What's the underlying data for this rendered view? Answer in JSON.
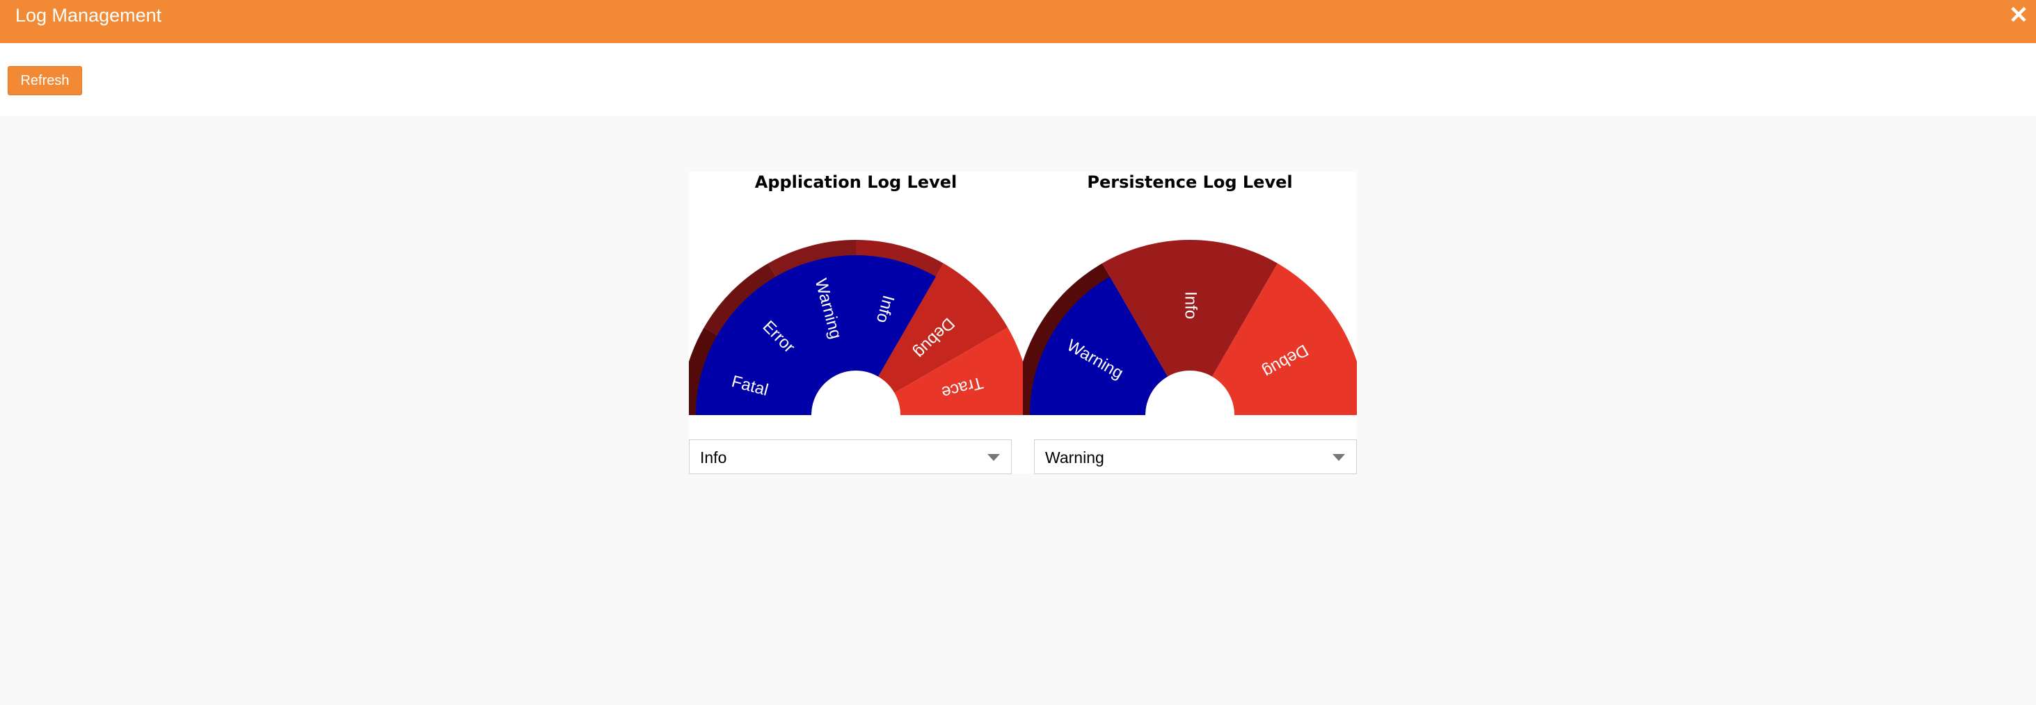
{
  "header": {
    "title": "Log Management",
    "close_icon": "close-icon"
  },
  "toolbar": {
    "refresh_label": "Refresh"
  },
  "colors": {
    "header_bg": "#f28a35",
    "selected": "#0000a8",
    "level_shades": [
      "#550a0a",
      "#6c1212",
      "#831818",
      "#9c1c1c",
      "#c5271e",
      "#e83628"
    ]
  },
  "application": {
    "title": "Application Log Level",
    "levels": [
      "Fatal",
      "Error",
      "Warning",
      "Info",
      "Debug",
      "Trace"
    ],
    "selected": "Info"
  },
  "persistence": {
    "title": "Persistence Log Level",
    "levels": [
      "Warning",
      "Info",
      "Debug"
    ],
    "selected": "Warning"
  }
}
